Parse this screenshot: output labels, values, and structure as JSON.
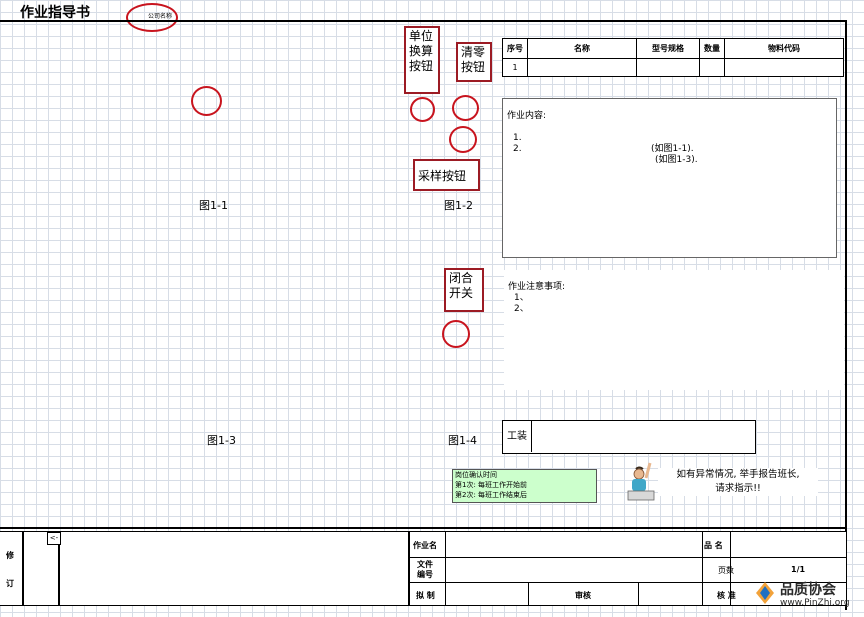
{
  "header": {
    "title": "作业指导书",
    "company": "公司名称"
  },
  "callouts": {
    "unit_convert": [
      "单位",
      "换算",
      "按钮"
    ],
    "zero": [
      "清零",
      "按钮"
    ],
    "sample": "采样按钮",
    "close_switch": [
      "闭合",
      "开关"
    ]
  },
  "figures": {
    "f1": "图1-1",
    "f2": "图1-2",
    "f3": "图1-3",
    "f4": "图1-4"
  },
  "parts_table": {
    "headers": [
      "序号",
      "名称",
      "型号规格",
      "数量",
      "物料代码"
    ],
    "rows": [
      [
        "1",
        "",
        "",
        "",
        ""
      ]
    ]
  },
  "work_content": {
    "title": "作业内容:",
    "line1_no": "1.",
    "line1_ref": "(如图1-1).",
    "line2_no": "2.",
    "line2_ref": "(如图1-3)."
  },
  "notes": {
    "title": "作业注意事项:",
    "line1": "1、",
    "line2": "2、"
  },
  "fixture": {
    "label": "工装",
    "value": ""
  },
  "checks": {
    "line1": "岗位确认时间",
    "line2": "第1次: 每班工作开始前",
    "line3": "第2次: 每班工作结束后"
  },
  "alert": {
    "line1": "如有异常情况, 举手报告班长,",
    "line2": "请求指示!!"
  },
  "revision": {
    "label1": "修",
    "label2": "订",
    "mark": "<-"
  },
  "footer": {
    "job_name_label": "作业名",
    "job_name": "",
    "product_label": "品 名",
    "product": "",
    "file_no_label_1": "文件",
    "file_no_label_2": "编号",
    "file_no": "",
    "pages_label": "页数",
    "pages": "1/1",
    "drafted_label": "拟 制",
    "reviewed_label": "审核",
    "approved_label": "核 准"
  },
  "watermark": {
    "name": "品质协会",
    "url": "www.PinZhi.org"
  }
}
